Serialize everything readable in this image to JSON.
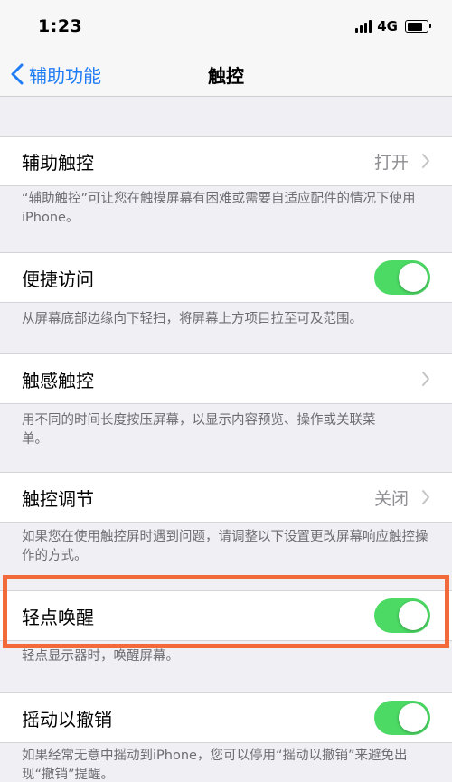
{
  "status_bar": {
    "time": "1:23",
    "network": "4G"
  },
  "nav": {
    "back_label": "辅助功能",
    "title": "触控"
  },
  "settings": {
    "assistive_touch": {
      "label": "辅助触控",
      "value": "打开",
      "note": "“辅助触控”可让您在触摸屏幕有困难或需要自适应配件的情况下使用iPhone。"
    },
    "reachability": {
      "label": "便捷访问",
      "on": true,
      "note": "从屏幕底部边缘向下轻扫，将屏幕上方项目拉至可及范围。"
    },
    "haptic_touch": {
      "label": "触感触控",
      "note": "用不同的时间长度按压屏幕，以显示内容预览、操作或关联菜单。"
    },
    "touch_accommodations": {
      "label": "触控调节",
      "value": "关闭",
      "note": "如果您在使用触控屏时遇到问题，请调整以下设置更改屏幕响应触控操作的方式。"
    },
    "tap_to_wake": {
      "label": "轻点唤醒",
      "on": true,
      "note": "轻点显示器时，唤醒屏幕。"
    },
    "shake_to_undo": {
      "label": "摇动以撤销",
      "on": true,
      "note": "如果经常无意中摇动到iPhone，您可以停用“摇动以撤销”来避免出现“撤销”提醒。"
    }
  },
  "colors": {
    "accent": "#1f7cf5",
    "toggle_on": "#4cd964",
    "highlight": "#f2693a"
  }
}
